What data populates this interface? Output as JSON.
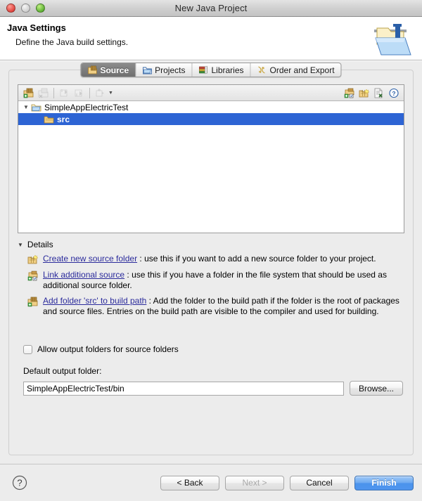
{
  "window": {
    "title": "New Java Project",
    "controls": {
      "close": "close-button",
      "minimize": "minimize-button",
      "zoom": "zoom-button"
    }
  },
  "header": {
    "title": "Java Settings",
    "description": "Define the Java build settings.",
    "icon": "java-project-folder-icon"
  },
  "tabs": [
    {
      "label": "Source",
      "icon": "source-folder-icon",
      "selected": true
    },
    {
      "label": "Projects",
      "icon": "projects-folder-icon",
      "selected": false
    },
    {
      "label": "Libraries",
      "icon": "libraries-books-icon",
      "selected": false
    },
    {
      "label": "Order and Export",
      "icon": "order-export-arrows-icon",
      "selected": false
    }
  ],
  "tree_toolbar": {
    "left_icons": [
      {
        "name": "add-folder-icon",
        "enabled": true
      },
      {
        "name": "remove-folder-icon",
        "enabled": false
      },
      {
        "name": "move-up-icon",
        "enabled": false
      },
      {
        "name": "move-down-icon",
        "enabled": false
      },
      {
        "name": "filter-icon",
        "enabled": false
      }
    ],
    "right_icons": [
      {
        "name": "link-source-icon",
        "enabled": true
      },
      {
        "name": "create-source-folder-icon",
        "enabled": true
      },
      {
        "name": "remove-entry-icon",
        "enabled": true
      },
      {
        "name": "help-hint-icon",
        "enabled": true
      }
    ]
  },
  "tree": {
    "rows": [
      {
        "label": "SimpleAppElectricTest",
        "level": 0,
        "expanded": true,
        "selected": false,
        "icon": "project-folder-icon"
      },
      {
        "label": "src",
        "level": 1,
        "expanded": false,
        "selected": true,
        "icon": "source-folder-icon"
      }
    ]
  },
  "details": {
    "header_label": "Details",
    "expanded": true,
    "items": [
      {
        "icon": "create-new-source-folder-icon",
        "link": "Create new source folder",
        "text": " : use this if you want to add a new source folder to your project."
      },
      {
        "icon": "link-additional-source-icon",
        "link": "Link additional source",
        "text": " : use this if you have a folder in the file system that should be used as additional source folder."
      },
      {
        "icon": "add-folder-to-build-path-icon",
        "link": "Add folder 'src' to build path",
        "text": " : Add the folder to the build path if the folder is the root of packages and source files. Entries on the build path are visible to the compiler and used for building."
      }
    ]
  },
  "allow_output": {
    "label": "Allow output folders for source folders",
    "checked": false
  },
  "output_folder": {
    "label": "Default output folder:",
    "value": "SimpleAppElectricTest/bin",
    "placeholder": "",
    "browse_label": "Browse..."
  },
  "footer": {
    "help_icon": "help-question-icon",
    "buttons": [
      {
        "label": "< Back",
        "enabled": true,
        "primary": false
      },
      {
        "label": "Next >",
        "enabled": false,
        "primary": false
      },
      {
        "label": "Cancel",
        "enabled": true,
        "primary": false
      },
      {
        "label": "Finish",
        "enabled": true,
        "primary": true
      }
    ]
  },
  "colors": {
    "selection_blue": "#2d64d4",
    "link_blue": "#2b2b9c",
    "window_bg": "#ececec",
    "primary_button": "#4b93ec",
    "tab_selected_bg": "#6f6f6f"
  }
}
